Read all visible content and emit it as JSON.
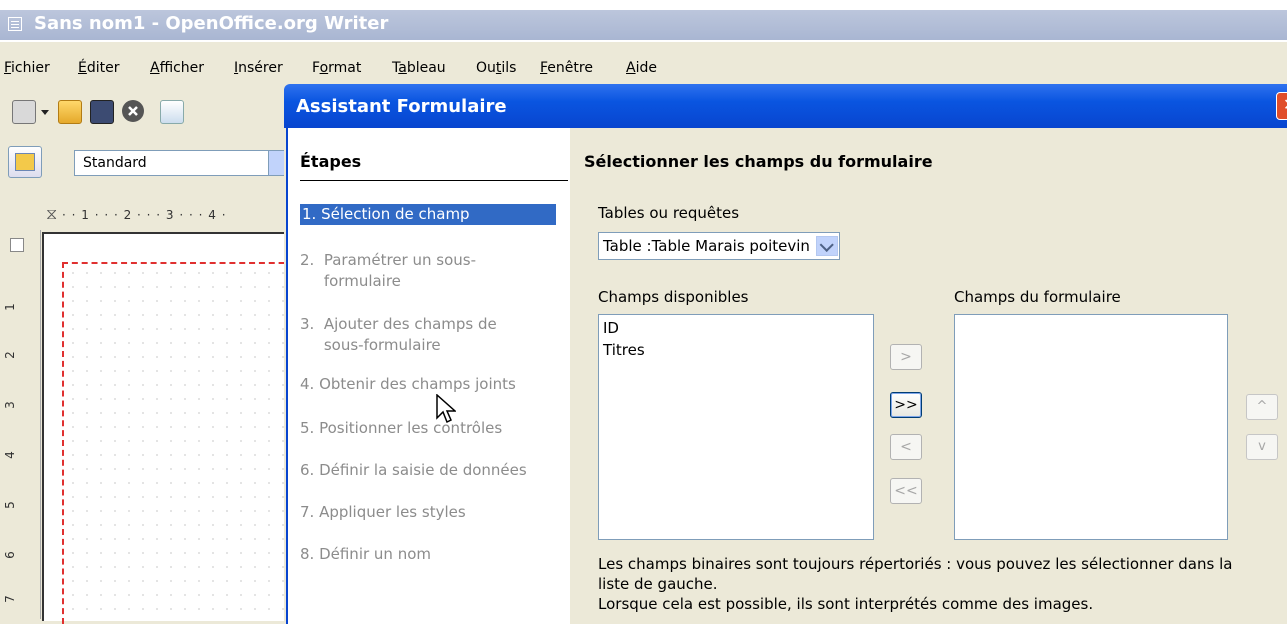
{
  "window": {
    "title": "Sans nom1 - OpenOffice.org Writer"
  },
  "menu": {
    "items": [
      {
        "pre": "",
        "key": "F",
        "post": "ichier"
      },
      {
        "pre": "",
        "key": "É",
        "post": "diter"
      },
      {
        "pre": "",
        "key": "A",
        "post": "fficher"
      },
      {
        "pre": "",
        "key": "I",
        "post": "nsérer"
      },
      {
        "pre": "F",
        "key": "o",
        "post": "rmat"
      },
      {
        "pre": "T",
        "key": "a",
        "post": "bleau"
      },
      {
        "pre": "Ou",
        "key": "t",
        "post": "ils"
      },
      {
        "pre": "",
        "key": "F",
        "post": "enêtre"
      },
      {
        "pre": "",
        "key": "A",
        "post": "ide"
      }
    ]
  },
  "formatting": {
    "paragraph_style": "Standard"
  },
  "ruler": {
    "horizontal": "· · 1 · · · 2 · · · 3 · · · 4 ·",
    "vertical": [
      "1",
      "2",
      "3",
      "4",
      "5",
      "6",
      "7"
    ]
  },
  "dialog": {
    "title": "Assistant Formulaire",
    "close_glyph": "✕",
    "steps_heading": "Étapes",
    "steps": [
      {
        "label": "1.  Sélection de champ",
        "active": true
      },
      {
        "label": "2.  Paramétrer un sous-\n     formulaire",
        "active": false
      },
      {
        "label": "3.  Ajouter des champs de\n     sous-formulaire",
        "active": false
      },
      {
        "label": "4.  Obtenir des champs joints",
        "active": false
      },
      {
        "label": "5.  Positionner les contrôles",
        "active": false
      },
      {
        "label": "6.  Définir la saisie de données",
        "active": false
      },
      {
        "label": "7.  Appliquer les styles",
        "active": false
      },
      {
        "label": "8.  Définir un nom",
        "active": false
      }
    ],
    "content_heading": "Sélectionner les champs du formulaire",
    "tables_label": "Tables ou requêtes",
    "tables_value": "Table :Table Marais poitevin",
    "available_label": "Champs disponibles",
    "available_fields": [
      "ID",
      "Titres"
    ],
    "form_fields_label": "Champs du formulaire",
    "buttons": {
      "add_one": ">",
      "add_all": ">>",
      "remove_one": "<",
      "remove_all": "<<",
      "move_up": "^",
      "move_down": "v"
    },
    "info_lines": [
      "Les champs binaires sont toujours répertoriés : vous pouvez les sélectionner dans la",
      "liste de gauche.",
      "Lorsque cela est possible, ils sont interprétés comme des images."
    ]
  }
}
